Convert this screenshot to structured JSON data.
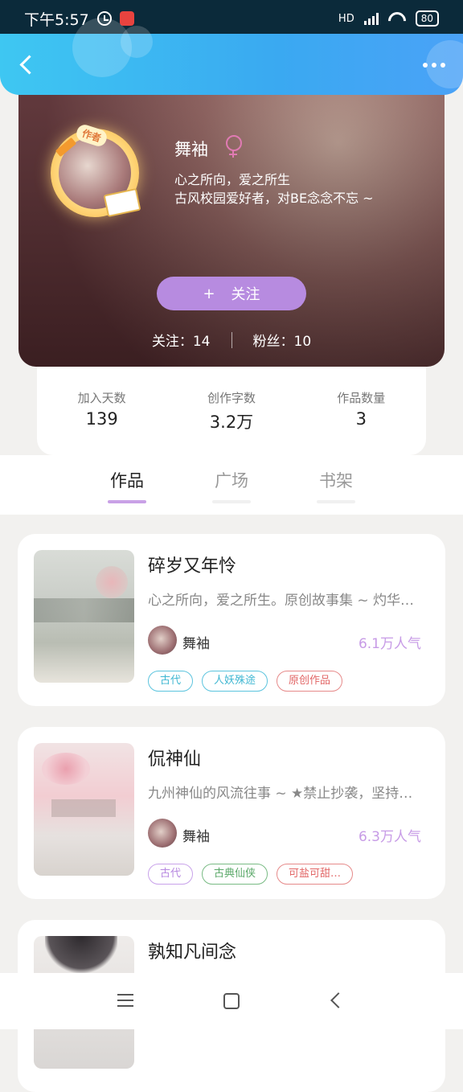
{
  "status_bar": {
    "time": "下午5:57",
    "network": "HD",
    "battery": "80"
  },
  "profile": {
    "name": "舞袖",
    "badge": "作者",
    "bio_line1": "心之所向，爱之所生",
    "bio_line2": "古风校园爱好者，对BE念念不忘 ~",
    "follow_icon": "+",
    "follow_label": "关注",
    "following": "关注：14",
    "fans": "粉丝：10"
  },
  "stats": [
    {
      "label": "加入天数",
      "value": "139"
    },
    {
      "label": "创作字数",
      "value": "3.2万"
    },
    {
      "label": "作品数量",
      "value": "3"
    }
  ],
  "tabs": [
    {
      "label": "作品",
      "active": true
    },
    {
      "label": "广场",
      "active": false
    },
    {
      "label": "书架",
      "active": false
    }
  ],
  "works": [
    {
      "title": "碎岁又年怜",
      "desc": "心之所向，爱之所生。原创故事集 ~ 灼华…",
      "author": "舞袖",
      "popularity": "6.1万人气",
      "tags": [
        {
          "text": "古代",
          "color": "blue"
        },
        {
          "text": "人妖殊途",
          "color": "blue"
        },
        {
          "text": "原创作品",
          "color": "red"
        }
      ]
    },
    {
      "title": "侃神仙",
      "desc": "九州神仙的风流往事 ~ ★禁止抄袭，坚持…",
      "author": "舞袖",
      "popularity": "6.3万人气",
      "tags": [
        {
          "text": "古代",
          "color": "purple"
        },
        {
          "text": "古典仙侠",
          "color": "green"
        },
        {
          "text": "可盐可甜…",
          "color": "red"
        }
      ]
    },
    {
      "title": "孰知凡间念"
    }
  ],
  "colors": {
    "header": "#3aa9f1",
    "follow_button": "#b78be0",
    "popularity": "#c79be6",
    "tab_indicator": "#c9a1e6"
  }
}
